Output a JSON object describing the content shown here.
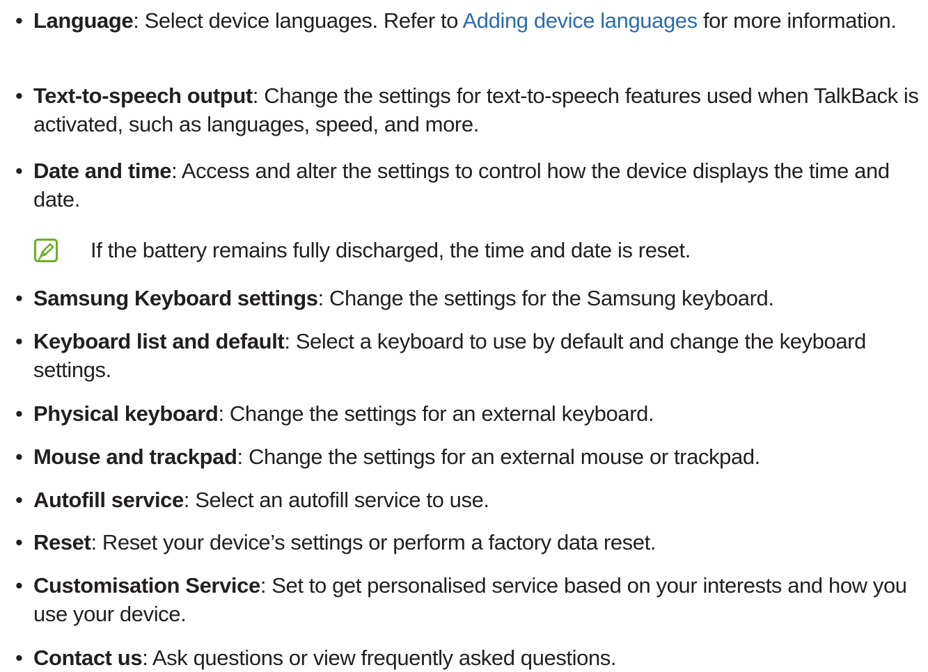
{
  "bullet_char": "•",
  "items": [
    {
      "term": "Language",
      "sep": ": ",
      "pre": "Select device languages. Refer to ",
      "link": "Adding device languages",
      "post": " for more information."
    },
    {
      "term": "Text-to-speech output",
      "sep": ": ",
      "text": "Change the settings for text-to-speech features used when TalkBack is activated, such as languages, speed, and more."
    },
    {
      "term": "Date and time",
      "sep": ": ",
      "text": "Access and alter the settings to control how the device displays the time and date."
    },
    {
      "term": "Samsung Keyboard settings",
      "sep": ": ",
      "text": "Change the settings for the Samsung keyboard."
    },
    {
      "term": "Keyboard list and default",
      "sep": ": ",
      "text": "Select a keyboard to use by default and change the keyboard settings."
    },
    {
      "term": "Physical keyboard",
      "sep": ": ",
      "text": "Change the settings for an external keyboard."
    },
    {
      "term": "Mouse and trackpad",
      "sep": ": ",
      "text": "Change the settings for an external mouse or trackpad."
    },
    {
      "term": "Autofill service",
      "sep": ": ",
      "text": "Select an autofill service to use."
    },
    {
      "term": "Reset",
      "sep": ": ",
      "text": "Reset your device’s settings or perform a factory data reset."
    },
    {
      "term": "Customisation Service",
      "sep": ": ",
      "text": "Set to get personalised service based on your interests and how you use your device."
    },
    {
      "term": "Contact us",
      "sep": ": ",
      "text": "Ask questions or view frequently asked questions."
    }
  ],
  "note": {
    "icon": "note-pencil-icon",
    "text": "If the battery remains fully discharged, the time and date is reset."
  },
  "colors": {
    "text": "#231f20",
    "link": "#2b6cb0",
    "note_icon": "#6ab023"
  }
}
